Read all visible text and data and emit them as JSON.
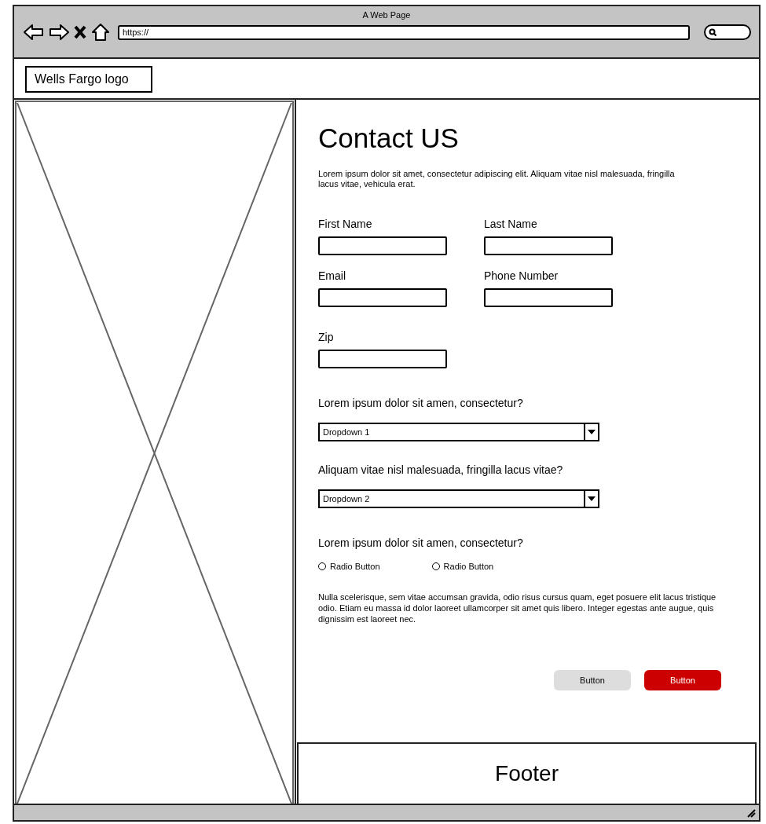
{
  "window": {
    "title": "A Web Page",
    "address": "https://"
  },
  "header": {
    "logo": "Wells Fargo logo"
  },
  "content": {
    "title": "Contact US",
    "intro": "Lorem ipsum dolor sit amet, consectetur adipiscing elit. Aliquam vitae nisl malesuada, fringilla lacus vitae, vehicula erat.",
    "fields": [
      {
        "label": "First Name"
      },
      {
        "label": "Last Name"
      },
      {
        "label": "Email"
      },
      {
        "label": "Phone Number"
      },
      {
        "label": "Zip"
      }
    ],
    "questions": [
      {
        "kind": "dropdown",
        "label": "Lorem ipsum dolor sit amen, consectetur?",
        "value": "Dropdown 1"
      },
      {
        "kind": "dropdown",
        "label": "Aliquam vitae nisl malesuada, fringilla lacus vitae?",
        "value": "Dropdown 2"
      },
      {
        "kind": "radio",
        "label": "Lorem ipsum dolor sit amen, consectetur?",
        "options": [
          {
            "label": "Radio Button",
            "selected": false
          },
          {
            "label": "Radio Button",
            "selected": false
          }
        ]
      }
    ],
    "note": "Nulla scelerisque, sem vitae accumsan gravida, odio risus cursus quam, eget posuere elit lacus tristique odio. Etiam eu massa id dolor laoreet ullamcorper sit amet quis libero. Integer egestas ante augue, quis dignissim est laoreet nec.",
    "buttons": [
      {
        "kind": "secondary",
        "label": "Button"
      },
      {
        "kind": "primary",
        "label": "Button"
      }
    ]
  },
  "footer": {
    "text": "Footer"
  }
}
